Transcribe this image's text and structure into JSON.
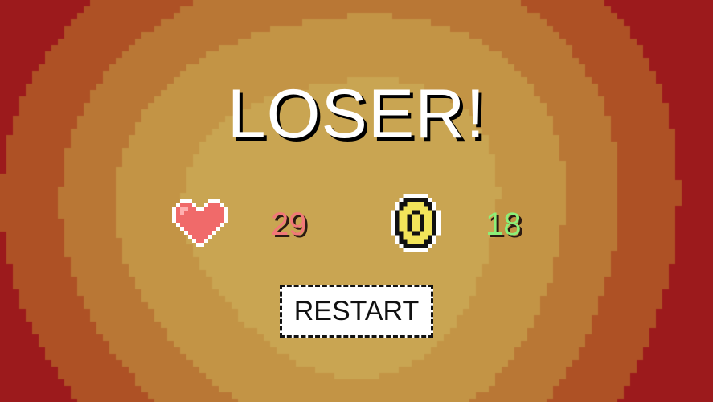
{
  "screen": {
    "title": "LOSER!",
    "stats": {
      "hearts": {
        "icon": "heart-icon",
        "value": "29",
        "color": "#f27878"
      },
      "coins": {
        "icon": "coin-icon",
        "value": "18",
        "color": "#8cf078"
      }
    },
    "restart_label": "RESTART"
  },
  "colors": {
    "background_rings": [
      "#9c1a1c",
      "#ae5125",
      "#b97735",
      "#c39445",
      "#c9a552"
    ],
    "title_text": "#ffffff",
    "title_shadow": "#000000",
    "button_background": "#ffffff",
    "button_border": "#111111"
  }
}
